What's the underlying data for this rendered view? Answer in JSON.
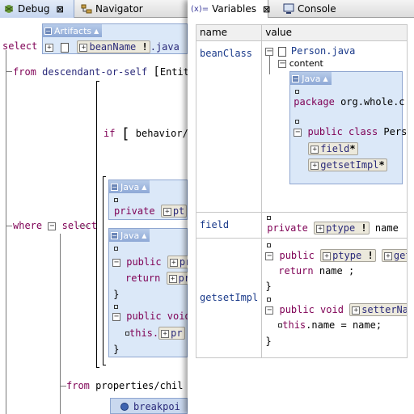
{
  "left_tabs": {
    "debug": "Debug",
    "navigator": "Navigator"
  },
  "right_tabs": {
    "variables": "Variables",
    "console": "Console"
  },
  "query": {
    "select_kw": "select",
    "from_kw": "from",
    "axis": "descendant-or-self",
    "entity_frag": "Entity",
    "if_kw": "if",
    "behavior_frag": "behavior/",
    "where_kw": "where",
    "select2_kw": "select",
    "from2_kw": "from",
    "props_frag": "properties/chil",
    "breakpoint_frag": "breakpoi"
  },
  "artifacts": {
    "title": "Artifacts",
    "bean_name": "beanName",
    "bang": "!",
    "ext": ".java"
  },
  "left_java1": {
    "title": "Java",
    "kw": "private",
    "chip": "pt"
  },
  "left_java2": {
    "title": "Java",
    "public_kw": "public",
    "return_kw": "return",
    "chip1": "pr",
    "chip2": "pr",
    "void_kw": "public void",
    "this_kw": "this.",
    "chip3": "pr"
  },
  "table": {
    "col_name": "name",
    "col_value": "value",
    "rows": [
      {
        "name": "beanClass"
      },
      {
        "name": "field"
      },
      {
        "name": "getsetImpl"
      }
    ]
  },
  "bean_class": {
    "file": "Person.java",
    "content": "content",
    "java_title": "Java",
    "package_kw": "package",
    "package_name": "org.whole.c",
    "public_class_kw": "public class",
    "class_name": "Perso",
    "field_chip": "field",
    "getset_chip": "getsetImpl",
    "star": "*"
  },
  "field_row": {
    "kw": "private",
    "chip": "ptype",
    "bang": "!",
    "name": "name"
  },
  "getset_row": {
    "public_kw": "public",
    "ptype_chip": "ptype",
    "bang": "!",
    "get_frag": "get",
    "return_kw": "return",
    "return_expr": "name ;",
    "public_void_kw": "public void",
    "setter_frag": "setterNam",
    "this_kw": "this",
    "assign": ".name = name;"
  }
}
